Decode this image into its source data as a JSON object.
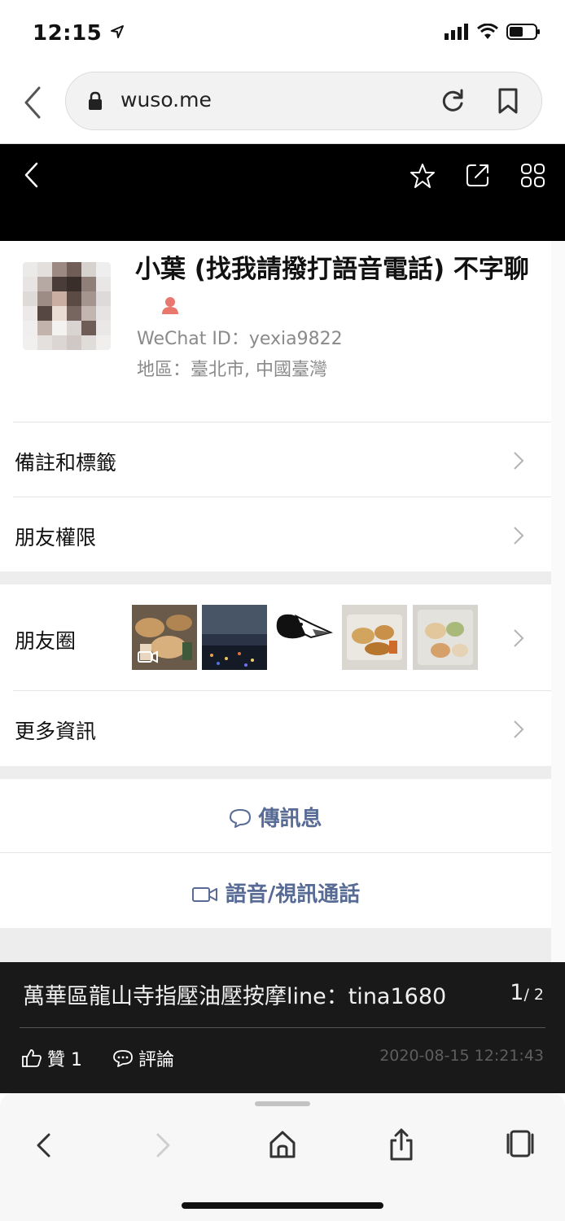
{
  "status": {
    "time": "12:15"
  },
  "browser": {
    "url": "wuso.me"
  },
  "profile": {
    "name": "小葉 (找我請撥打語音電話) 不字聊",
    "wechat_id": "WeChat ID：yexia9822",
    "region": "地區：臺北市, 中國臺灣"
  },
  "rows": {
    "remarks": "備註和標籤",
    "permissions": "朋友權限",
    "moments": "朋友圈",
    "more_info": "更多資訊"
  },
  "actions": {
    "message": "傳訊息",
    "call": "語音/視訊通話"
  },
  "caption": {
    "text": "萬華區龍山寺指壓油壓按摩line：tina1680",
    "page_current": "1",
    "page_total": "/ 2",
    "like_label": "贊 1",
    "comment_label": "評論",
    "timestamp": "2020-08-15 12:21:43"
  },
  "colors": {
    "wechat_link": "#576b95",
    "header_bg": "#000000",
    "gender_icon": "#e8776d"
  },
  "icons": [
    "location-arrow-icon",
    "signal-icon",
    "wifi-icon",
    "battery-icon",
    "lock-icon",
    "reload-icon",
    "bookmark-icon",
    "back-icon",
    "star-icon",
    "share-icon",
    "grid-icon",
    "female-icon",
    "chevron-right-icon",
    "chat-bubble-icon",
    "video-call-icon",
    "thumbs-up-icon",
    "comment-icon",
    "home-icon",
    "forward-icon",
    "tabs-icon"
  ]
}
